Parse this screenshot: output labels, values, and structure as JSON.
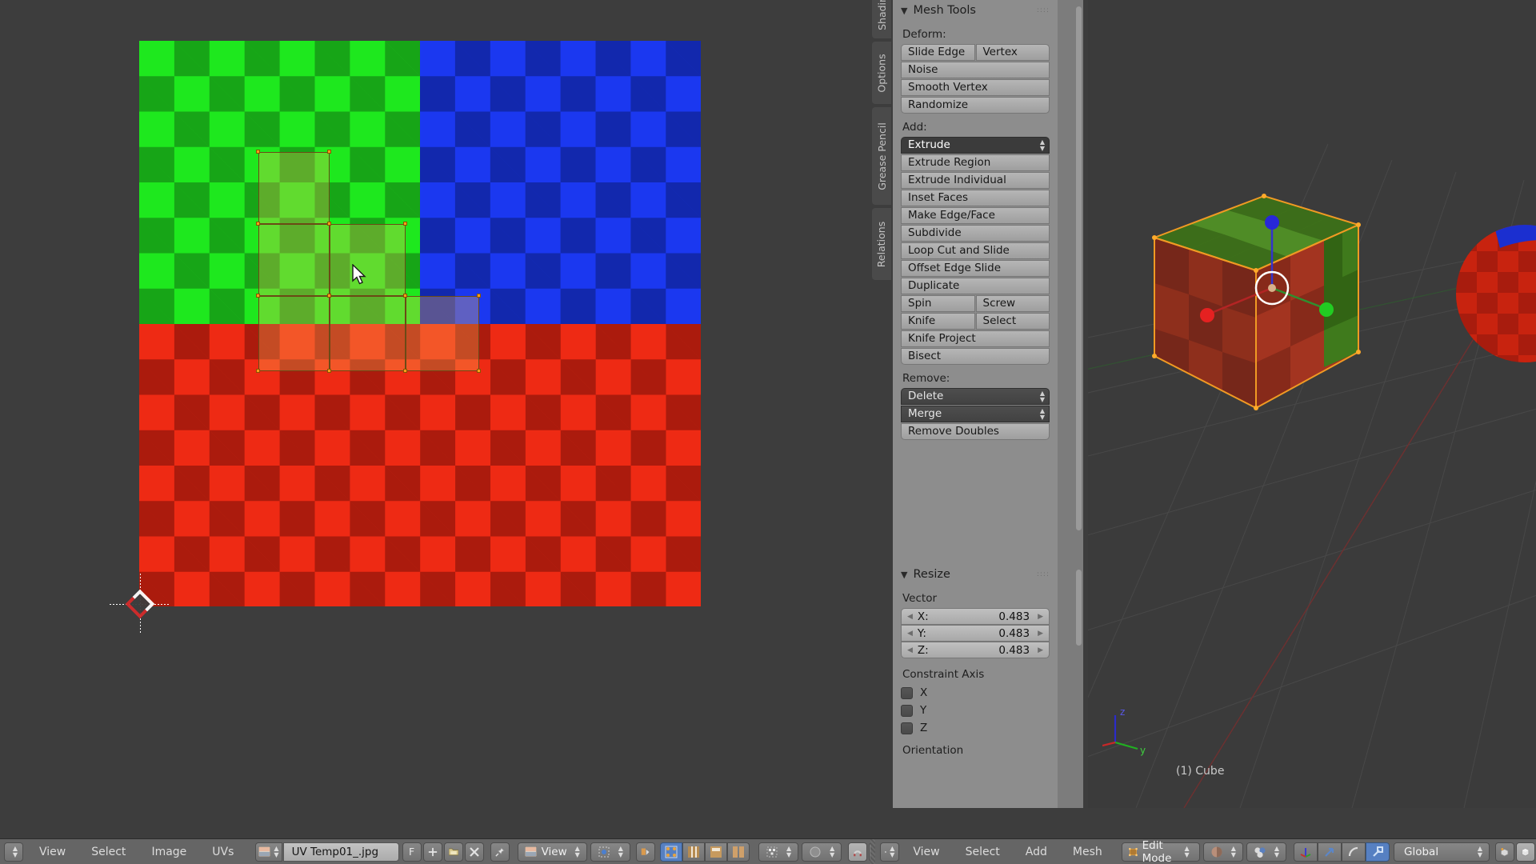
{
  "app": {
    "name": "Blender",
    "mode": "Edit Mode"
  },
  "tool_region": {
    "vertical_tabs": [
      {
        "label": "Shading",
        "active": false
      },
      {
        "label": "Options",
        "active": false
      },
      {
        "label": "Grease Pencil",
        "active": false
      },
      {
        "label": "Relations",
        "active": false
      }
    ],
    "panels": [
      {
        "title": "Mesh Tools",
        "sections": [
          {
            "label": "Deform:",
            "rows": [
              {
                "type": "pair",
                "items": [
                  "Slide Edge",
                  "Vertex"
                ]
              },
              {
                "type": "single",
                "items": [
                  "Noise"
                ]
              },
              {
                "type": "single",
                "items": [
                  "Smooth Vertex"
                ]
              },
              {
                "type": "single",
                "items": [
                  "Randomize"
                ]
              }
            ]
          },
          {
            "label": "Add:",
            "rows": [
              {
                "type": "menu",
                "items": [
                  "Extrude"
                ],
                "highlight": true
              },
              {
                "type": "single",
                "items": [
                  "Extrude Region"
                ]
              },
              {
                "type": "single",
                "items": [
                  "Extrude Individual"
                ]
              },
              {
                "type": "single",
                "items": [
                  "Inset Faces"
                ]
              },
              {
                "type": "single",
                "items": [
                  "Make Edge/Face"
                ]
              },
              {
                "type": "single",
                "items": [
                  "Subdivide"
                ]
              },
              {
                "type": "single",
                "items": [
                  "Loop Cut and Slide"
                ]
              },
              {
                "type": "single",
                "items": [
                  "Offset Edge Slide"
                ]
              },
              {
                "type": "single",
                "items": [
                  "Duplicate"
                ]
              },
              {
                "type": "pair",
                "items": [
                  "Spin",
                  "Screw"
                ]
              },
              {
                "type": "pair",
                "items": [
                  "Knife",
                  "Select"
                ]
              },
              {
                "type": "single",
                "items": [
                  "Knife Project"
                ]
              },
              {
                "type": "single",
                "items": [
                  "Bisect"
                ]
              }
            ]
          },
          {
            "label": "Remove:",
            "rows": [
              {
                "type": "menu",
                "items": [
                  "Delete"
                ]
              },
              {
                "type": "menu",
                "items": [
                  "Merge"
                ]
              },
              {
                "type": "single",
                "items": [
                  "Remove Doubles"
                ]
              }
            ]
          }
        ]
      },
      {
        "title": "Resize",
        "vector_label": "Vector",
        "vector": [
          {
            "label": "X:",
            "value": "0.483"
          },
          {
            "label": "Y:",
            "value": "0.483"
          },
          {
            "label": "Z:",
            "value": "0.483"
          }
        ],
        "constraint_label": "Constraint Axis",
        "constraints": [
          {
            "label": "X",
            "checked": false
          },
          {
            "label": "Y",
            "checked": false
          },
          {
            "label": "Z",
            "checked": false
          }
        ],
        "orientation_label": "Orientation"
      }
    ]
  },
  "uv_header": {
    "menus": [
      "View",
      "Select",
      "Image",
      "UVs"
    ],
    "image_icon": "image-icon",
    "image_name": "UV Temp01_.jpg",
    "fake_user_label": "F",
    "buttons": [
      {
        "name": "new-image-button",
        "glyph": "+"
      },
      {
        "name": "open-image-button",
        "glyph": "📁"
      },
      {
        "name": "unlink-image-button",
        "glyph": "✕"
      },
      {
        "name": "pin-button",
        "glyph": "📌"
      }
    ],
    "view_dropdown": "View",
    "pivot_icon": "pivot-icon",
    "sync_icon": "uv-sync-selection-icon",
    "select_modes": [
      "vertex-select-icon",
      "edge-select-icon",
      "face-select-icon",
      "island-select-icon"
    ],
    "sticky_icon": "sticky-selection-icon",
    "proportional_icon": "proportional-edit-icon",
    "snap_icon": "snap-magnet-icon",
    "snap_target_icon": "snap-target-icon"
  },
  "viewport_header": {
    "editor_icon": "3d-view-icon",
    "menus": [
      "View",
      "Select",
      "Add",
      "Mesh"
    ],
    "mode": "Edit Mode",
    "shading_icon": "viewport-shading-icon",
    "pivot_icon": "pivot-point-icon",
    "manipulators": [
      "translate-manipulator-icon",
      "rotate-manipulator-icon",
      "scale-manipulator-icon"
    ],
    "orientation": "Global",
    "snap_icon": "snap-icon",
    "layers_icon": "layers-icon"
  },
  "viewport": {
    "object_name": "(1) Cube",
    "axis_labels": {
      "z": "z",
      "y": "y"
    },
    "manipulator": "translate-manipulator",
    "objects": [
      "cube",
      "sphere"
    ]
  },
  "uv_editor": {
    "image_name": "UV Temp01_.jpg",
    "cursor_2d": "2d-cursor",
    "checker_quadrants": [
      {
        "name": "green-quadrant",
        "color": "#1ee81e",
        "dark": "#17a517"
      },
      {
        "name": "blue-quadrant",
        "color": "#1b38f0",
        "dark": "#1228ad"
      },
      {
        "name": "red-quadrant",
        "color": "#ee2a14",
        "dark": "#ab1b0d"
      }
    ],
    "selected_faces": 5,
    "face_color": "#ffbe5a"
  },
  "colors": {
    "panel_bg": "#8d8d8d",
    "region_bg": "#7c7c7c",
    "header_bg": "#656565",
    "viewport_bg": "#3b3b3b",
    "accent_orange": "#ff9d1a",
    "accent_blue": "#5680c2"
  }
}
